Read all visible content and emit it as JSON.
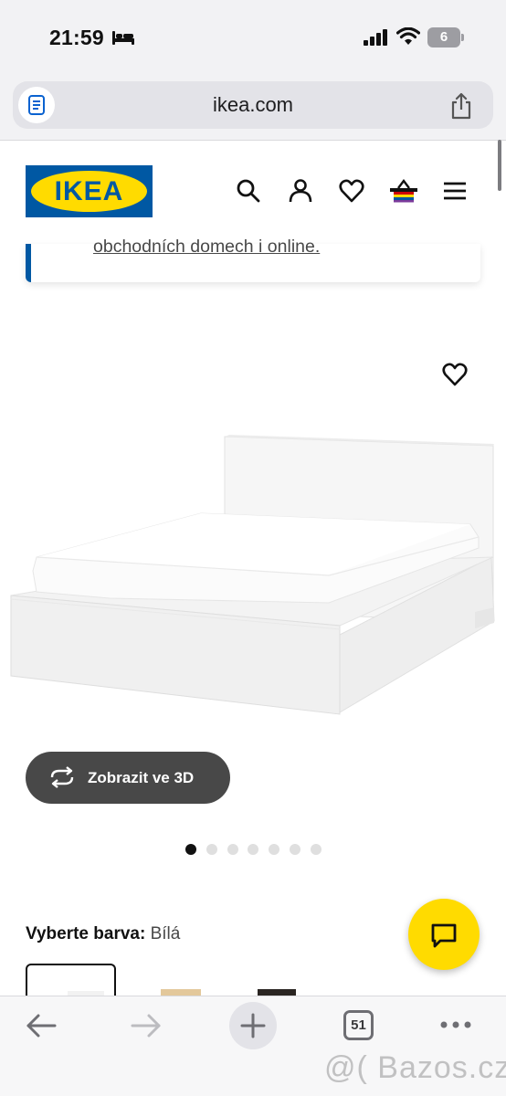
{
  "status_bar": {
    "time": "21:59",
    "focus_icon": "bed-icon",
    "battery_level": "6",
    "icons": [
      "signal-bars-icon",
      "wifi-icon",
      "battery-icon"
    ]
  },
  "browser": {
    "url": "ikea.com",
    "reader_icon": "reader-mode-icon",
    "share_icon": "share-icon"
  },
  "header": {
    "logo_text": "IKEA",
    "icons": [
      "search-icon",
      "account-icon",
      "heart-icon",
      "shopping-basket-icon",
      "menu-icon"
    ],
    "brand_colors": {
      "blue": "#0058a3",
      "yellow": "#ffdb00"
    }
  },
  "banner": {
    "link_text": "obchodních domech i online."
  },
  "product": {
    "favorite_icon": "heart-icon",
    "image_alt": "bed-frame-image",
    "view_3d_label": "Zobrazit ve 3D",
    "view_3d_icon": "rotate-3d-icon",
    "carousel": {
      "total": 7,
      "active_index": 0
    }
  },
  "color_select": {
    "label": "Vyberte barva:",
    "value": "Bílá",
    "swatches": [
      {
        "name": "Bílá",
        "color": "#f2f2f2",
        "selected": true
      },
      {
        "name": "oak",
        "color": "#e3c89b",
        "selected": false
      },
      {
        "name": "black",
        "color": "#2a2522",
        "selected": false
      }
    ]
  },
  "chat": {
    "icon": "chat-icon",
    "color": "#ffdb00"
  },
  "toolbar": {
    "back_icon": "back-arrow-icon",
    "forward_icon": "forward-arrow-icon",
    "new_tab_icon": "plus-icon",
    "tab_count": "51",
    "more_icon": "more-icon"
  },
  "watermark": "@( Bazos.cz"
}
